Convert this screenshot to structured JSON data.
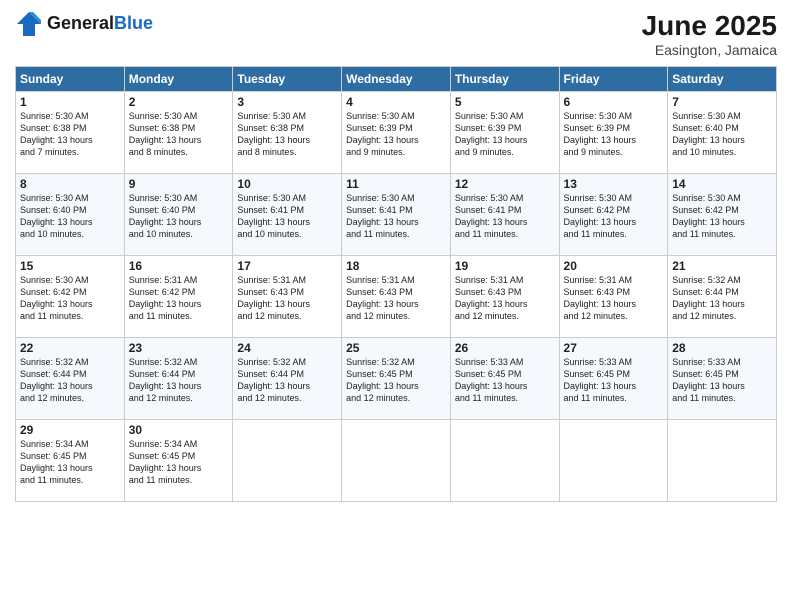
{
  "logo": {
    "general": "General",
    "blue": "Blue"
  },
  "header": {
    "month_year": "June 2025",
    "location": "Easington, Jamaica"
  },
  "weekdays": [
    "Sunday",
    "Monday",
    "Tuesday",
    "Wednesday",
    "Thursday",
    "Friday",
    "Saturday"
  ],
  "weeks": [
    [
      {
        "day": "1",
        "info": "Sunrise: 5:30 AM\nSunset: 6:38 PM\nDaylight: 13 hours\nand 7 minutes."
      },
      {
        "day": "2",
        "info": "Sunrise: 5:30 AM\nSunset: 6:38 PM\nDaylight: 13 hours\nand 8 minutes."
      },
      {
        "day": "3",
        "info": "Sunrise: 5:30 AM\nSunset: 6:38 PM\nDaylight: 13 hours\nand 8 minutes."
      },
      {
        "day": "4",
        "info": "Sunrise: 5:30 AM\nSunset: 6:39 PM\nDaylight: 13 hours\nand 9 minutes."
      },
      {
        "day": "5",
        "info": "Sunrise: 5:30 AM\nSunset: 6:39 PM\nDaylight: 13 hours\nand 9 minutes."
      },
      {
        "day": "6",
        "info": "Sunrise: 5:30 AM\nSunset: 6:39 PM\nDaylight: 13 hours\nand 9 minutes."
      },
      {
        "day": "7",
        "info": "Sunrise: 5:30 AM\nSunset: 6:40 PM\nDaylight: 13 hours\nand 10 minutes."
      }
    ],
    [
      {
        "day": "8",
        "info": "Sunrise: 5:30 AM\nSunset: 6:40 PM\nDaylight: 13 hours\nand 10 minutes."
      },
      {
        "day": "9",
        "info": "Sunrise: 5:30 AM\nSunset: 6:40 PM\nDaylight: 13 hours\nand 10 minutes."
      },
      {
        "day": "10",
        "info": "Sunrise: 5:30 AM\nSunset: 6:41 PM\nDaylight: 13 hours\nand 10 minutes."
      },
      {
        "day": "11",
        "info": "Sunrise: 5:30 AM\nSunset: 6:41 PM\nDaylight: 13 hours\nand 11 minutes."
      },
      {
        "day": "12",
        "info": "Sunrise: 5:30 AM\nSunset: 6:41 PM\nDaylight: 13 hours\nand 11 minutes."
      },
      {
        "day": "13",
        "info": "Sunrise: 5:30 AM\nSunset: 6:42 PM\nDaylight: 13 hours\nand 11 minutes."
      },
      {
        "day": "14",
        "info": "Sunrise: 5:30 AM\nSunset: 6:42 PM\nDaylight: 13 hours\nand 11 minutes."
      }
    ],
    [
      {
        "day": "15",
        "info": "Sunrise: 5:30 AM\nSunset: 6:42 PM\nDaylight: 13 hours\nand 11 minutes."
      },
      {
        "day": "16",
        "info": "Sunrise: 5:31 AM\nSunset: 6:42 PM\nDaylight: 13 hours\nand 11 minutes."
      },
      {
        "day": "17",
        "info": "Sunrise: 5:31 AM\nSunset: 6:43 PM\nDaylight: 13 hours\nand 12 minutes."
      },
      {
        "day": "18",
        "info": "Sunrise: 5:31 AM\nSunset: 6:43 PM\nDaylight: 13 hours\nand 12 minutes."
      },
      {
        "day": "19",
        "info": "Sunrise: 5:31 AM\nSunset: 6:43 PM\nDaylight: 13 hours\nand 12 minutes."
      },
      {
        "day": "20",
        "info": "Sunrise: 5:31 AM\nSunset: 6:43 PM\nDaylight: 13 hours\nand 12 minutes."
      },
      {
        "day": "21",
        "info": "Sunrise: 5:32 AM\nSunset: 6:44 PM\nDaylight: 13 hours\nand 12 minutes."
      }
    ],
    [
      {
        "day": "22",
        "info": "Sunrise: 5:32 AM\nSunset: 6:44 PM\nDaylight: 13 hours\nand 12 minutes."
      },
      {
        "day": "23",
        "info": "Sunrise: 5:32 AM\nSunset: 6:44 PM\nDaylight: 13 hours\nand 12 minutes."
      },
      {
        "day": "24",
        "info": "Sunrise: 5:32 AM\nSunset: 6:44 PM\nDaylight: 13 hours\nand 12 minutes."
      },
      {
        "day": "25",
        "info": "Sunrise: 5:32 AM\nSunset: 6:45 PM\nDaylight: 13 hours\nand 12 minutes."
      },
      {
        "day": "26",
        "info": "Sunrise: 5:33 AM\nSunset: 6:45 PM\nDaylight: 13 hours\nand 11 minutes."
      },
      {
        "day": "27",
        "info": "Sunrise: 5:33 AM\nSunset: 6:45 PM\nDaylight: 13 hours\nand 11 minutes."
      },
      {
        "day": "28",
        "info": "Sunrise: 5:33 AM\nSunset: 6:45 PM\nDaylight: 13 hours\nand 11 minutes."
      }
    ],
    [
      {
        "day": "29",
        "info": "Sunrise: 5:34 AM\nSunset: 6:45 PM\nDaylight: 13 hours\nand 11 minutes."
      },
      {
        "day": "30",
        "info": "Sunrise: 5:34 AM\nSunset: 6:45 PM\nDaylight: 13 hours\nand 11 minutes."
      },
      null,
      null,
      null,
      null,
      null
    ]
  ]
}
